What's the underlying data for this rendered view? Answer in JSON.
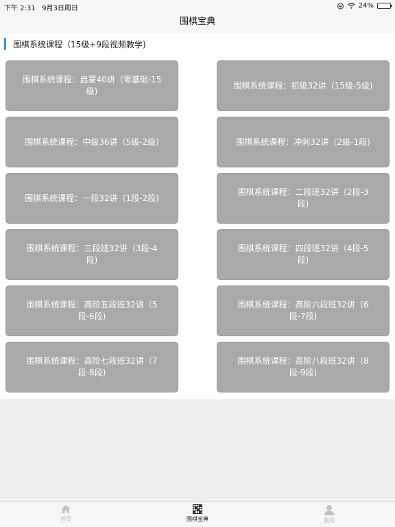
{
  "status_bar": {
    "time": "下午 2:31",
    "date": "9月3日周日",
    "battery": "24%",
    "battery_level": 0.24
  },
  "nav": {
    "title": "围棋宝典"
  },
  "section": {
    "title": "围棋系统课程（15级+9段视频教学)"
  },
  "courses": [
    "围棋系统课程：启蒙40讲（零基础-15级)",
    "围棋系统课程：初级32讲（15级-5级)",
    "围棋系统课程：中级36讲（5级-2级)",
    "围棋系统课程：冲刺32讲（2级-1段)",
    "围棋系统课程：一段32讲（1段-2段)",
    "围棋系统课程：二段班32讲（2段-3段)",
    "围棋系统课程：三段班32讲（3段-4段)",
    "围棋系统课程：四段班32讲（4段-5段)",
    "围棋系统课程：高阶五段班32讲（5段-6段)",
    "围棋系统课程：高阶六段班32讲（6段-7段)",
    "围棋系统课程：高阶七段班32讲（7段-8段)",
    "围棋系统课程：高阶八段班32讲（8段-9段)"
  ],
  "tabs": [
    {
      "label": "首页",
      "icon": "home-icon"
    },
    {
      "label": "围棋宝典",
      "icon": "go-board-icon",
      "active": true
    },
    {
      "label": "我的",
      "icon": "person-icon"
    }
  ],
  "colors": {
    "button_bg": "#a9a9ab",
    "accent_bar": "#2f9ed8",
    "active_tab": "#222222",
    "inactive_tab": "#bdbdbd"
  }
}
